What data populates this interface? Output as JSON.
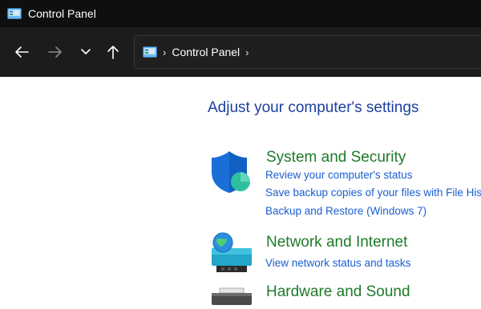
{
  "window": {
    "title": "Control Panel"
  },
  "navigation": {
    "back_icon": "back-arrow-icon",
    "forward_icon": "forward-arrow-icon",
    "recent_icon": "chevron-down-icon",
    "up_icon": "up-arrow-icon",
    "address_path": [
      "Control Panel"
    ]
  },
  "main": {
    "heading": "Adjust your computer's settings",
    "categories": [
      {
        "title": "System and Security",
        "icon": "shield-icon",
        "links": [
          "Review your computer's status",
          "Save backup copies of your files with File History",
          "Backup and Restore (Windows 7)"
        ]
      },
      {
        "title": "Network and Internet",
        "icon": "network-globe-icon",
        "links": [
          "View network status and tasks"
        ]
      },
      {
        "title": "Hardware and Sound",
        "icon": "printer-icon",
        "links": []
      }
    ]
  },
  "colors": {
    "titlebar": "#0f0f0f",
    "navbar": "#1c1c1c",
    "heading": "#1d3f9e",
    "category_title": "#1f7a2a",
    "link": "#1a5fd1"
  }
}
